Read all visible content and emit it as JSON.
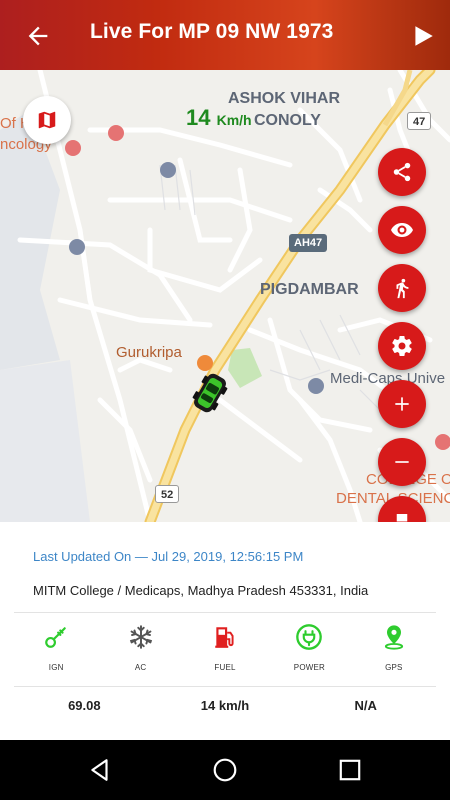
{
  "header": {
    "title": "Live For MP 09 NW 1973"
  },
  "map": {
    "speed_value": "14",
    "speed_unit": "Km/h",
    "labels": {
      "ashok_vihar_1": "ASHOK VIHAR",
      "ashok_vihar_2": "CONOLY",
      "pigdambar": "PIGDAMBAR",
      "gurukripa": "Gurukripa",
      "medicaps": "Medi-Caps Unive",
      "oncology_1": "Of H",
      "oncology_2": "ncology",
      "college_1": "COLLEGE OF",
      "college_2": "DENTAL SCIENCES"
    },
    "shields": {
      "ah47": "AH47",
      "r47": "47",
      "r52": "52"
    }
  },
  "details": {
    "last_updated": "Last Updated On — Jul 29, 2019, 12:56:15 PM",
    "address": "MITM College / Medicaps, Madhya Pradesh 453331, India",
    "status": [
      {
        "label": "IGN",
        "icon": "key-icon",
        "color": "#2ecc2e"
      },
      {
        "label": "AC",
        "icon": "snowflake-icon",
        "color": "#555555"
      },
      {
        "label": "FUEL",
        "icon": "fuel-pump-icon",
        "color": "#e02020"
      },
      {
        "label": "POWER",
        "icon": "power-plug-icon",
        "color": "#2ecc2e"
      },
      {
        "label": "GPS",
        "icon": "gps-pin-icon",
        "color": "#2ecc2e"
      }
    ],
    "stats": [
      "69.08",
      "14 km/h",
      "N/A"
    ]
  },
  "colors": {
    "accent_red": "#d71a1a",
    "header_red": "#c12b10",
    "link_blue": "#3d86c7",
    "speed_green": "#1f8a1f"
  }
}
